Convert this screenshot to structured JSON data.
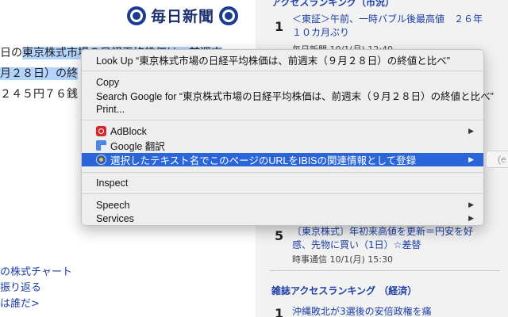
{
  "article": {
    "masthead": "毎日新聞",
    "line1_plain": "日の",
    "line1_selected": "東京株式市場の日経平均株価は、前週末",
    "line2": "月２８日）の終",
    "line3": "２４５円７６銭",
    "links": [
      "の株式チャート",
      "振り返る",
      "は誰だ>",
      "..."
    ]
  },
  "sidebar": {
    "top_heading": "アクセスランキング（市況）",
    "items": [
      {
        "rank": "1",
        "title": "＜東証＞午前、一時バブル後最高値　２６年１０カ月ぶり",
        "meta": "毎日新聞 10/1(月) 12:40"
      },
      {
        "rank": "5",
        "title": "〔東京株式〕年初来高値を更新＝円安を好感、先物に買い（1日）☆差替",
        "meta": "時事通信 10/1(月) 15:30"
      }
    ],
    "mid_heading": "雑誌アクセスランキング （経済）",
    "bottom_item": {
      "rank": "1",
      "title": "沖縄敗北が3選後の安倍政権を痛"
    }
  },
  "context_menu": {
    "look_up": "Look Up “東京株式市場の日経平均株価は、前週末（９月２８日）の終値と比べ”",
    "copy": "Copy",
    "search_google": "Search Google for “東京株式市場の日経平均株価は、前週末（９月２８日）の終値と比べ”",
    "print": "Print...",
    "adblock": "AdBlock",
    "google_translate": "Google 翻訳",
    "ibis": "選択したテキスト名でこのページのURLをIBISの関連情報として登録",
    "inspect": "Inspect",
    "speech": "Speech",
    "services": "Services",
    "submenu_arrow": "▶",
    "submenu_stub": "(e"
  },
  "colors": {
    "highlight": "#2a66d9",
    "link": "#1b3ea8",
    "selection": "#b3d4fc"
  }
}
